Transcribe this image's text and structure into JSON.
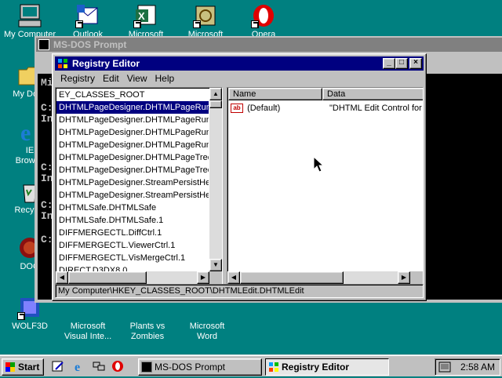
{
  "desktop": {
    "icons": [
      {
        "id": "mycomputer",
        "label": "My Computer"
      },
      {
        "id": "outlook",
        "label": "Outlook"
      },
      {
        "id": "excel",
        "label": "Microsoft"
      },
      {
        "id": "ms2",
        "label": "Microsoft"
      },
      {
        "id": "opera",
        "label": "Opera"
      },
      {
        "id": "mydocs",
        "label": "My Docu"
      },
      {
        "id": "ie",
        "label": "IE\nBrowse"
      },
      {
        "id": "recycle",
        "label": "Recycle"
      },
      {
        "id": "doom",
        "label": "DOO"
      },
      {
        "id": "wolf3d",
        "label": "WOLF3D"
      },
      {
        "id": "visualinte",
        "label": "Microsoft\nVisual Inte..."
      },
      {
        "id": "pvz",
        "label": "Plants vs\nZombies"
      },
      {
        "id": "word",
        "label": "Microsoft\nWord"
      }
    ]
  },
  "dos_window": {
    "title": "MS-DOS Prompt",
    "lines": [
      "Mi",
      "C:",
      "In",
      "C:",
      "In",
      "C:",
      "In",
      "C:"
    ]
  },
  "registry": {
    "title": "Registry Editor",
    "menu": {
      "registry": "Registry",
      "edit": "Edit",
      "view": "View",
      "help": "Help"
    },
    "tree_items": [
      "EY_CLASSES_ROOT",
      "DHTMLPageDesigner.DHTMLPageRunt",
      "DHTMLPageDesigner.DHTMLPageRunt",
      "DHTMLPageDesigner.DHTMLPageRunt",
      "DHTMLPageDesigner.DHTMLPageRunt",
      "DHTMLPageDesigner.DHTMLPageTree",
      "DHTMLPageDesigner.DHTMLPageTree",
      "DHTMLPageDesigner.StreamPersistHelp",
      "DHTMLPageDesigner.StreamPersistHelp",
      "DHTMLSafe.DHTMLSafe",
      "DHTMLSafe.DHTMLSafe.1",
      "DIFFMERGECTL.DiffCtrl.1",
      "DIFFMERGECTL.ViewerCtrl.1",
      "DIFFMERGECTL.VisMergeCtrl.1",
      "DIRECT.D3DX8.0"
    ],
    "selected_index": 1,
    "columns": {
      "name": "Name",
      "data": "Data"
    },
    "values": [
      {
        "icon": "ab",
        "name": "(Default)",
        "data": "\"DHTML Edit Control for I"
      }
    ],
    "status": "My Computer\\HKEY_CLASSES_ROOT\\DHTMLEdit.DHTMLEdit"
  },
  "taskbar": {
    "start": "Start",
    "tasks": [
      {
        "label": "MS-DOS Prompt",
        "active": false
      },
      {
        "label": "Registry Editor",
        "active": true
      }
    ],
    "clock": "2:58 AM"
  },
  "colors": {
    "desktop": "#008080",
    "title_active": "#000080",
    "title_inactive": "#808080"
  }
}
